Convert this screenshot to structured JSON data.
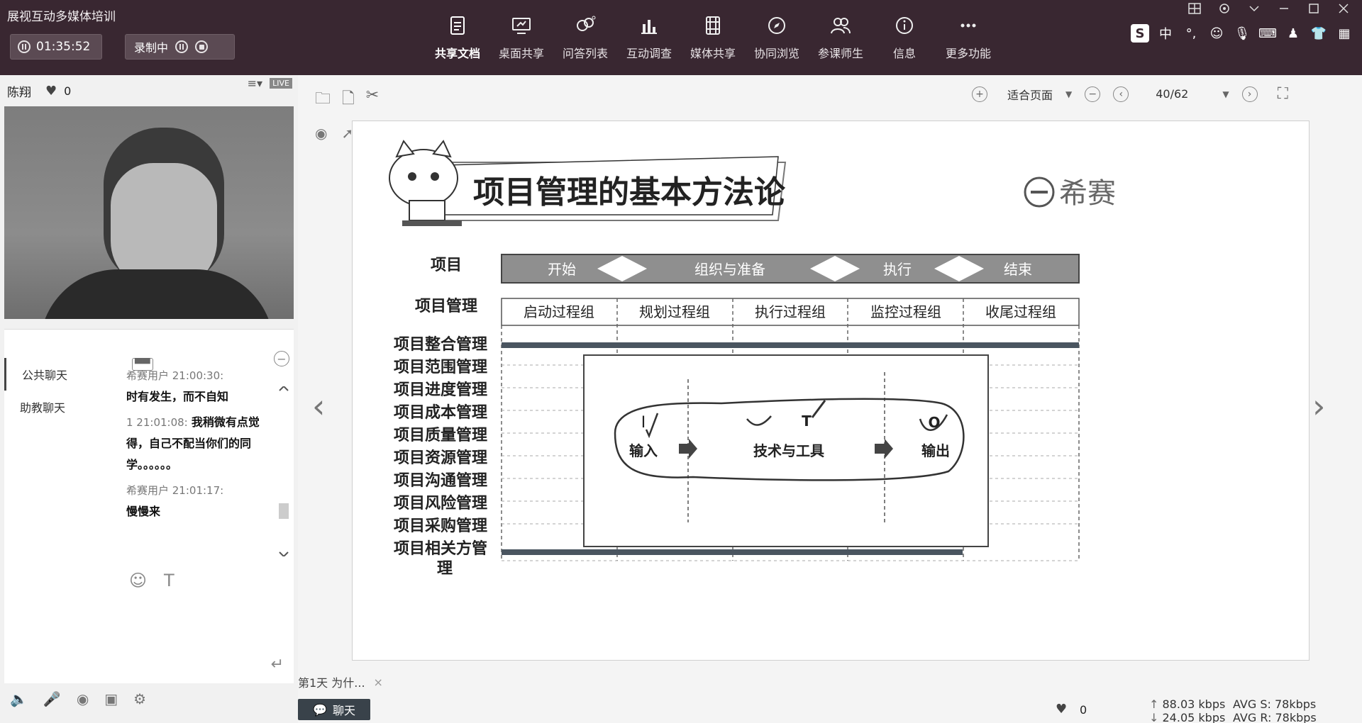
{
  "app": {
    "title": "展视互动多媒体培训"
  },
  "session": {
    "timer": "01:35:52",
    "recording_label": "录制中"
  },
  "toolbar": {
    "items": [
      {
        "label": "共享文档",
        "icon": "document-icon"
      },
      {
        "label": "桌面共享",
        "icon": "monitor-icon"
      },
      {
        "label": "问答列表",
        "icon": "qa-icon"
      },
      {
        "label": "互动调查",
        "icon": "chart-icon"
      },
      {
        "label": "媒体共享",
        "icon": "film-icon"
      },
      {
        "label": "协同浏览",
        "icon": "compass-icon"
      },
      {
        "label": "参课师生",
        "icon": "users-icon"
      },
      {
        "label": "信息",
        "icon": "info-icon"
      },
      {
        "label": "更多功能",
        "icon": "more-icon"
      }
    ]
  },
  "tray": {
    "ime": "中"
  },
  "presenter": {
    "name": "陈翔",
    "likes": "0",
    "live": "LIVE"
  },
  "chat": {
    "tabs": [
      {
        "label": "公共聊天"
      },
      {
        "label": "助教聊天"
      }
    ],
    "messages": [
      {
        "meta": "希赛用户 21:00:30:",
        "text": "时有发生，而不自知"
      },
      {
        "meta": "1 21:01:08:",
        "text": "我稍微有点觉得，自己不配当你们的同学。。。。。。"
      },
      {
        "meta": "希赛用户 21:01:17:",
        "text": "慢慢来"
      }
    ]
  },
  "viewer": {
    "fit_label": "适合页面",
    "page": "40/62"
  },
  "slide": {
    "title": "项目管理的基本方法论",
    "brand": "希赛",
    "row_project": "项目",
    "row_pm": "项目管理",
    "phases": [
      "开始",
      "组织与准备",
      "执行",
      "结束"
    ],
    "process_groups": [
      "启动过程组",
      "规划过程组",
      "执行过程组",
      "监控过程组",
      "收尾过程组"
    ],
    "knowledge_areas": [
      "项目整合管理",
      "项目范围管理",
      "项目进度管理",
      "项目成本管理",
      "项目质量管理",
      "项目资源管理",
      "项目沟通管理",
      "项目风险管理",
      "项目采购管理",
      "项目相关方管",
      "理"
    ],
    "ito": {
      "input": "输入",
      "tools": "技术与工具",
      "output": "输出",
      "i": "I",
      "t": "T",
      "o": "O"
    }
  },
  "doc_tab": {
    "label": "第1天 为什..."
  },
  "status": {
    "chat_button": "聊天",
    "likes": "0",
    "send": "88.03 kbps",
    "recv": "24.05 kbps",
    "avg_s": "AVG S: 78kbps",
    "avg_r": "AVG R: 78kbps"
  },
  "colors": {
    "topbar": "#392731",
    "phase_bar": "#8f8f8f",
    "dark_bar": "#4a5560"
  }
}
